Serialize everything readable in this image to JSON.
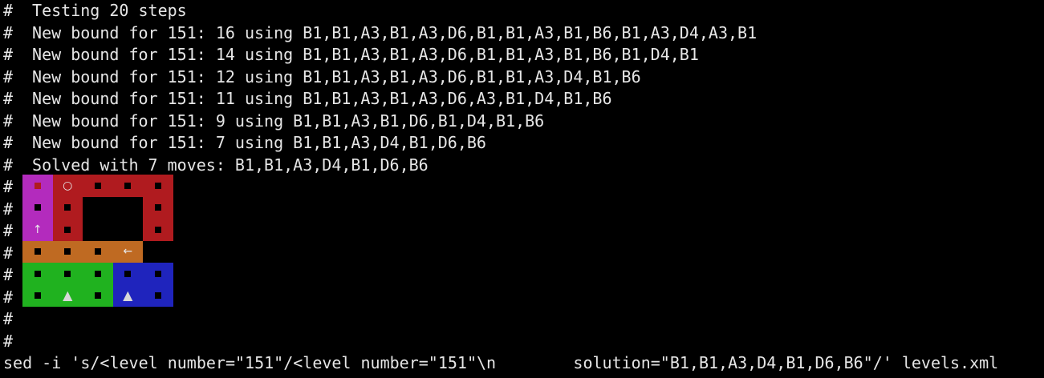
{
  "colors": {
    "background": "#000000",
    "text": "#e6e6e6",
    "magenta": "#b32bbd",
    "red": "#b01b1f",
    "orange": "#bf6a22",
    "green": "#20b21f",
    "blue": "#1f24bd"
  },
  "lines": [
    {
      "prefix": "#",
      "text": " Testing 20 steps"
    },
    {
      "prefix": "#",
      "text": " New bound for 151: 16 using B1,B1,A3,B1,A3,D6,B1,B1,A3,B1,B6,B1,A3,D4,A3,B1"
    },
    {
      "prefix": "#",
      "text": " New bound for 151: 14 using B1,B1,A3,B1,A3,D6,B1,B1,A3,B1,B6,B1,D4,B1"
    },
    {
      "prefix": "#",
      "text": " New bound for 151: 12 using B1,B1,A3,B1,A3,D6,B1,B1,A3,D4,B1,B6"
    },
    {
      "prefix": "#",
      "text": " New bound for 151: 11 using B1,B1,A3,B1,A3,D6,A3,B1,D4,B1,B6"
    },
    {
      "prefix": "#",
      "text": " New bound for 151: 9 using B1,B1,A3,B1,D6,B1,D4,B1,B6"
    },
    {
      "prefix": "#",
      "text": " New bound for 151: 7 using B1,B1,A3,D4,B1,D6,B6"
    },
    {
      "prefix": "#",
      "text": " Solved with 7 moves: B1,B1,A3,D4,B1,D6,B6"
    },
    {
      "prefix": "#",
      "text": ""
    },
    {
      "prefix": "#",
      "text": ""
    },
    {
      "prefix": "#",
      "text": ""
    },
    {
      "prefix": "#",
      "text": ""
    },
    {
      "prefix": "#",
      "text": ""
    },
    {
      "prefix": "#",
      "text": ""
    },
    {
      "prefix": "#",
      "text": ""
    },
    {
      "prefix": "#",
      "text": ""
    },
    {
      "prefix": "",
      "text": "sed -i 's/<level number=\"151\"/<level number=\"151\"\\n        solution=\"B1,B1,A3,D4,B1,D6,B6\"/' levels.xml"
    }
  ],
  "board": {
    "rows": [
      [
        {
          "c": "magenta",
          "m": "dot-red"
        },
        {
          "c": "red",
          "m": "circle"
        },
        {
          "c": "red",
          "m": "dot"
        },
        {
          "c": "red",
          "m": "dot"
        },
        {
          "c": "red",
          "m": "dot"
        }
      ],
      [
        {
          "c": "magenta",
          "m": "dot"
        },
        {
          "c": "red",
          "m": "dot"
        },
        {
          "c": "black",
          "m": ""
        },
        {
          "c": "black",
          "m": ""
        },
        {
          "c": "red",
          "m": "dot"
        }
      ],
      [
        {
          "c": "magenta",
          "m": "up"
        },
        {
          "c": "red",
          "m": "dot"
        },
        {
          "c": "black",
          "m": ""
        },
        {
          "c": "black",
          "m": ""
        },
        {
          "c": "red",
          "m": "dot"
        }
      ],
      [
        {
          "c": "orange",
          "m": "dot"
        },
        {
          "c": "orange",
          "m": "dot"
        },
        {
          "c": "orange",
          "m": "dot"
        },
        {
          "c": "orange",
          "m": "left"
        },
        {
          "c": "black",
          "m": ""
        }
      ],
      [
        {
          "c": "green",
          "m": "dot"
        },
        {
          "c": "green",
          "m": "dot"
        },
        {
          "c": "green",
          "m": "dot"
        },
        {
          "c": "blue",
          "m": "dot"
        },
        {
          "c": "blue",
          "m": "dot"
        }
      ],
      [
        {
          "c": "green",
          "m": "dot"
        },
        {
          "c": "green",
          "m": "tri"
        },
        {
          "c": "green",
          "m": "dot"
        },
        {
          "c": "blue",
          "m": "tri"
        },
        {
          "c": "blue",
          "m": "dot"
        }
      ]
    ],
    "symbols": {
      "circle": "○",
      "up": "↑",
      "left": "←",
      "tri": "▲"
    }
  }
}
